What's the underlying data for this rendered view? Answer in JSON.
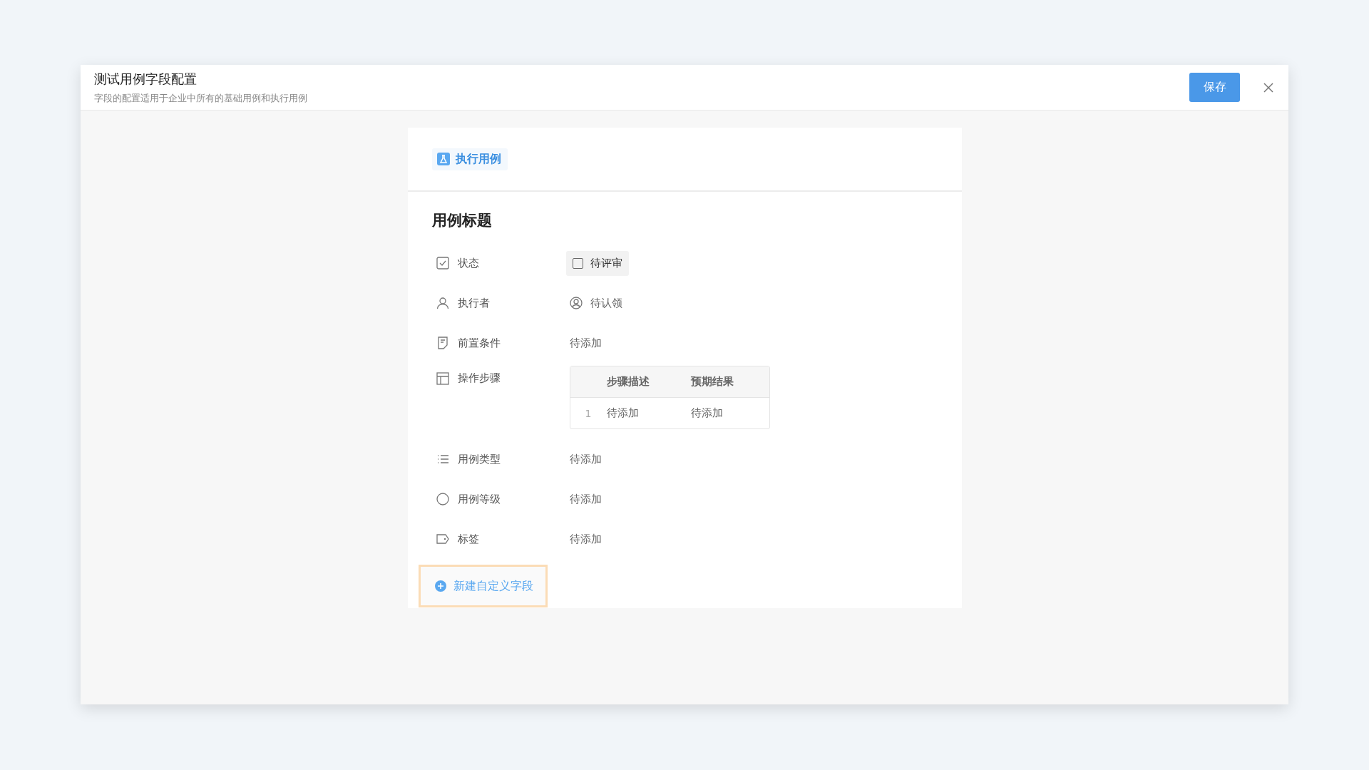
{
  "dialog": {
    "title": "测试用例字段配置",
    "subtitle": "字段的配置适用于企业中所有的基础用例和执行用例",
    "save_button": "保存"
  },
  "card": {
    "tab": {
      "label": "执行用例",
      "selected": true
    },
    "heading": "用例标题",
    "fields": [
      {
        "kind": "status",
        "label": "状态",
        "value": "待评审",
        "checked": false
      },
      {
        "kind": "assignee",
        "label": "执行者",
        "value": "待认领"
      },
      {
        "kind": "precondition",
        "label": "前置条件",
        "value": "待添加"
      },
      {
        "kind": "steps",
        "label": "操作步骤",
        "table": {
          "columns": [
            "步骤描述",
            "预期结果"
          ],
          "rows": [
            {
              "index": "1",
              "cells": [
                "待添加",
                "待添加"
              ]
            }
          ]
        }
      },
      {
        "kind": "type",
        "label": "用例类型",
        "value": "待添加"
      },
      {
        "kind": "level",
        "label": "用例等级",
        "value": "待添加"
      },
      {
        "kind": "tags",
        "label": "标签",
        "value": "待添加"
      }
    ],
    "add_field_button": "新建自定义字段"
  }
}
